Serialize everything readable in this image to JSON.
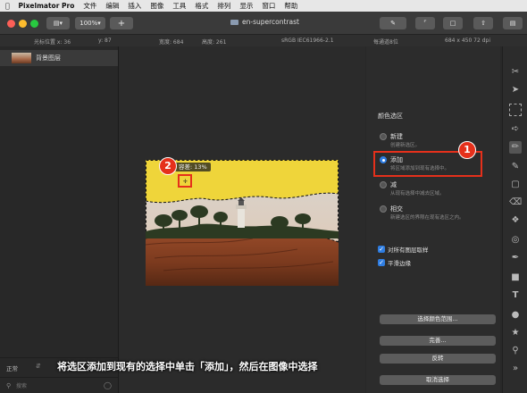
{
  "menubar": {
    "app_name": "Pixelmator Pro",
    "items": [
      "文件",
      "编辑",
      "插入",
      "图像",
      "工具",
      "格式",
      "排列",
      "显示",
      "窗口",
      "帮助"
    ]
  },
  "toolbar": {
    "zoom": "100%",
    "plus": "+",
    "document_title": "en-supercontrast"
  },
  "infobar": {
    "cursor_x": "光标位置 x:  36",
    "cursor_y": "y:  87",
    "width": "宽度:  684",
    "height": "高度:  261",
    "profile": "sRGB IEC61966-2.1",
    "depth": "每通道8位",
    "size": "684 x 450 72 dpi"
  },
  "layers": {
    "items": [
      {
        "name": "背景图层"
      }
    ],
    "blend_mode": "正常",
    "search_placeholder": "搜索"
  },
  "canvas": {
    "tolerance": "容差: 13%"
  },
  "color_select": {
    "section_title": "颜色选区",
    "options": [
      {
        "label": "新建",
        "desc": "创建新选区。",
        "selected": false
      },
      {
        "label": "添加",
        "desc": "将区域添加到现有选择中。",
        "selected": true
      },
      {
        "label": "减",
        "desc": "从现有选择中减去区域。",
        "selected": false
      },
      {
        "label": "相交",
        "desc": "新建选区的界限在现有选区之内。",
        "selected": false
      }
    ],
    "sample_all_layers": "对所有图层取样",
    "smooth_edges": "平滑边缘",
    "select_color_range": "选择颜色范围...",
    "done": "完善...",
    "invert": "反转",
    "deselect": "取消选择"
  },
  "annotations": {
    "badge1": "1",
    "badge2": "2",
    "caption": "将选区添加到现有的选择中单击「添加」，然后在图像中选择"
  },
  "colors": {
    "accent": "#2f7de1",
    "badge": "#e5301b",
    "selection_fill": "#efd53a"
  }
}
